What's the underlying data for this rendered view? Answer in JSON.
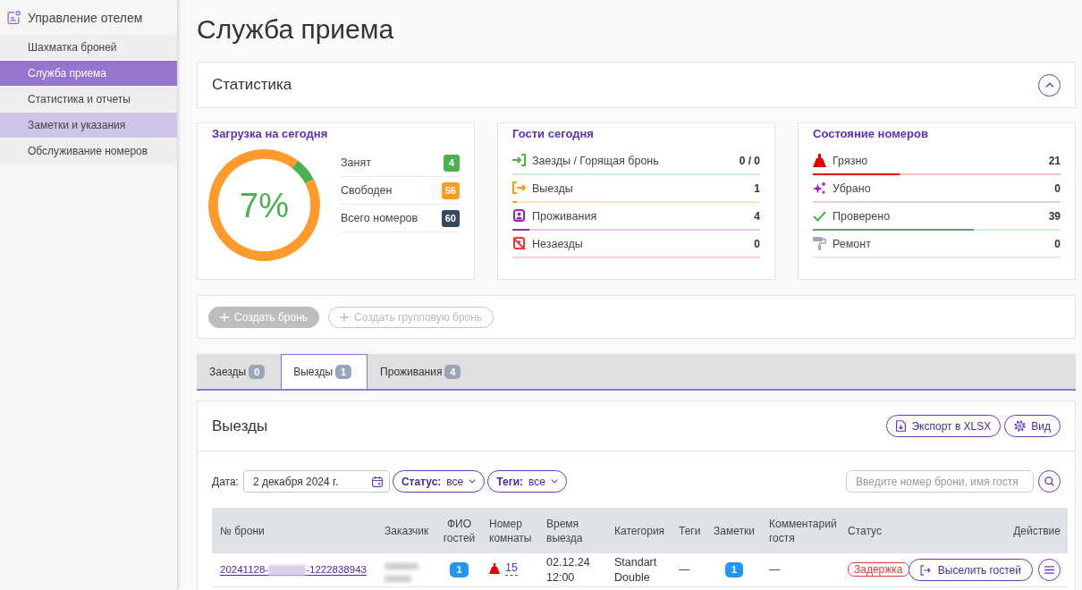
{
  "sidebar": {
    "title": "Управление отелем",
    "items": [
      {
        "label": "Шахматка броней",
        "selected": false,
        "highlighted": false
      },
      {
        "label": "Служба приема",
        "selected": true,
        "highlighted": false
      },
      {
        "label": "Статистика и отчеты",
        "selected": false,
        "highlighted": false
      },
      {
        "label": "Заметки и указания",
        "selected": false,
        "highlighted": true
      },
      {
        "label": "Обслуживание номеров",
        "selected": false,
        "highlighted": false
      }
    ]
  },
  "page_title": "Служба приема",
  "statistics": {
    "title": "Статистика",
    "expanded": true,
    "occupancy": {
      "title": "Загрузка на сегодня",
      "percent": "7%",
      "chart_data": {
        "type": "donut",
        "values": [
          7,
          93
        ]
      },
      "legend": [
        {
          "label": "Занят",
          "value": "4",
          "color": "#4caf50"
        },
        {
          "label": "Свободен",
          "value": "56",
          "color": "#ff9a2e"
        },
        {
          "label": "Всего номеров",
          "value": "60",
          "color": "#34495e"
        }
      ]
    },
    "guests": {
      "title": "Гости сегодня",
      "rows": [
        {
          "kind": "arrivals",
          "label": "Заезды / Горящая бронь",
          "value": "0 / 0",
          "level": 0,
          "color": "#4caf50"
        },
        {
          "kind": "departures",
          "label": "Выезды",
          "value": "1",
          "level": 0.017,
          "color": "#ff9800"
        },
        {
          "kind": "stays",
          "label": "Проживания",
          "value": "4",
          "level": 0.067,
          "color": "#9c27b0"
        },
        {
          "kind": "no_shows",
          "label": "Незаезды",
          "value": "0",
          "level": 0,
          "color": "#e53935"
        }
      ]
    },
    "rooms": {
      "title": "Состояние номеров",
      "rows": [
        {
          "kind": "dirty",
          "label": "Грязно",
          "value": "21",
          "level": 0.35,
          "color": "#e00000"
        },
        {
          "kind": "cleaned",
          "label": "Убрано",
          "value": "0",
          "level": 0,
          "color": "#9c27b0"
        },
        {
          "kind": "inspected",
          "label": "Проверено",
          "value": "39",
          "level": 0.65,
          "color": "#4caf50"
        },
        {
          "kind": "repair",
          "label": "Ремонт",
          "value": "0",
          "level": 0,
          "color": "#9ea7b3"
        }
      ]
    }
  },
  "actions": [
    {
      "kind": "primary",
      "label": "Создать бронь",
      "disabled": true
    },
    {
      "kind": "secondary",
      "label": "Создать групповую бронь",
      "disabled": true
    }
  ],
  "tabs": [
    {
      "label": "Заезды",
      "count": "0",
      "selected": false
    },
    {
      "label": "Выезды",
      "count": "1",
      "selected": true
    },
    {
      "label": "Проживания",
      "count": "4",
      "selected": false
    }
  ],
  "departures": {
    "title": "Выезды",
    "buttons": [
      {
        "kind": "export",
        "label": "Экспорт в XLSX"
      },
      {
        "kind": "view",
        "label": "Вид"
      }
    ],
    "filters": {
      "date": {
        "label": "Дата:",
        "value": "2 декабря 2024 г."
      },
      "dropdowns": [
        {
          "label": "Статус:",
          "value": "все"
        },
        {
          "label": "Теги:",
          "value": "все"
        }
      ],
      "search": {
        "placeholder": "Введите номер брони, имя гостя"
      }
    },
    "table": {
      "columns": [
        "№ брони",
        "Заказчик",
        "ФИО гостей",
        "Номер комнаты",
        "Время выезда",
        "Категория",
        "Теги",
        "Заметки",
        "Комментарий гостя",
        "Статус",
        "Действие"
      ],
      "rows": [
        {
          "booking": {
            "prefix": "20241128-",
            "redacted": true,
            "suffix": "-1222838943"
          },
          "customer": {
            "redacted": true
          },
          "guests": "1",
          "room": {
            "kind": "dirty",
            "number": "15"
          },
          "checkout": {
            "date": "02.12.24",
            "time": "12:00"
          },
          "category": "Standart Double",
          "tags": "—",
          "notes": "1",
          "comment": "—",
          "status": "Задержка",
          "action": "Выселить гостей"
        }
      ]
    }
  }
}
